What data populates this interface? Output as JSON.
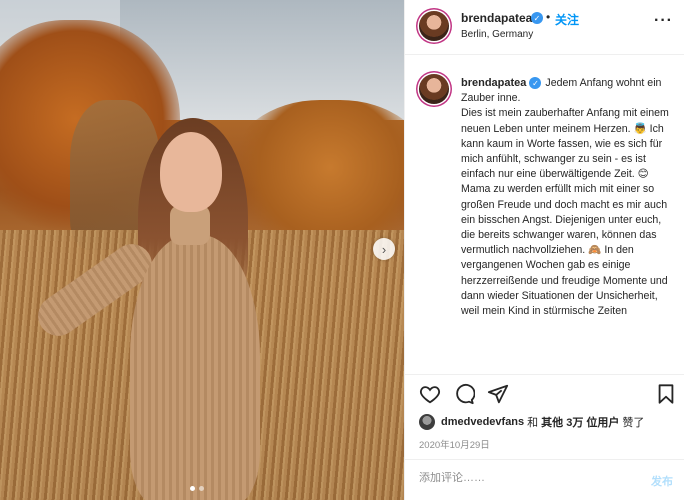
{
  "post": {
    "username": "brendapatea",
    "follow_label": "关注",
    "location": "Berlin, Germany",
    "separator": "•",
    "more_icon": "···"
  },
  "media": {
    "next_icon": "›",
    "carousel": {
      "count": 2,
      "active_index": 0
    }
  },
  "caption": {
    "username": "brendapatea",
    "text": "Jedem Anfang wohnt ein Zauber inne.\nDies ist mein zauberhafter Anfang mit einem neuen Leben unter meinem Herzen. 👼 Ich kann kaum in Worte fassen, wie es sich für mich anfühlt, schwanger zu sein - es ist einfach nur eine überwältigende Zeit. 😊 Mama zu werden erfüllt mich mit einer so großen Freude und doch macht es mir auch ein bisschen Angst. Diejenigen unter euch, die bereits schwanger waren, können das vermutlich nachvollziehen. 🙈 In den vergangenen Wochen gab es einige herzzerreißende und freudige Momente und dann wieder Situationen der Unsicherheit, weil mein Kind in stürmische Zeiten"
  },
  "actions": {
    "like_icon": "heart-icon",
    "comment_icon": "comment-icon",
    "share_icon": "share-icon",
    "save_icon": "bookmark-icon"
  },
  "likes": {
    "liker": "dmedvedevfans",
    "and": "和",
    "others": "其他 3万 位用户",
    "suffix": "赞了"
  },
  "date": "2020年10月29日",
  "comment": {
    "placeholder": "添加评论……",
    "post_label": "发布"
  },
  "colors": {
    "link_blue": "#0095f6",
    "verified_blue": "#3897f0",
    "post_disabled": "#b2dffc",
    "border": "#efefef",
    "muted": "#8e8e8e"
  }
}
